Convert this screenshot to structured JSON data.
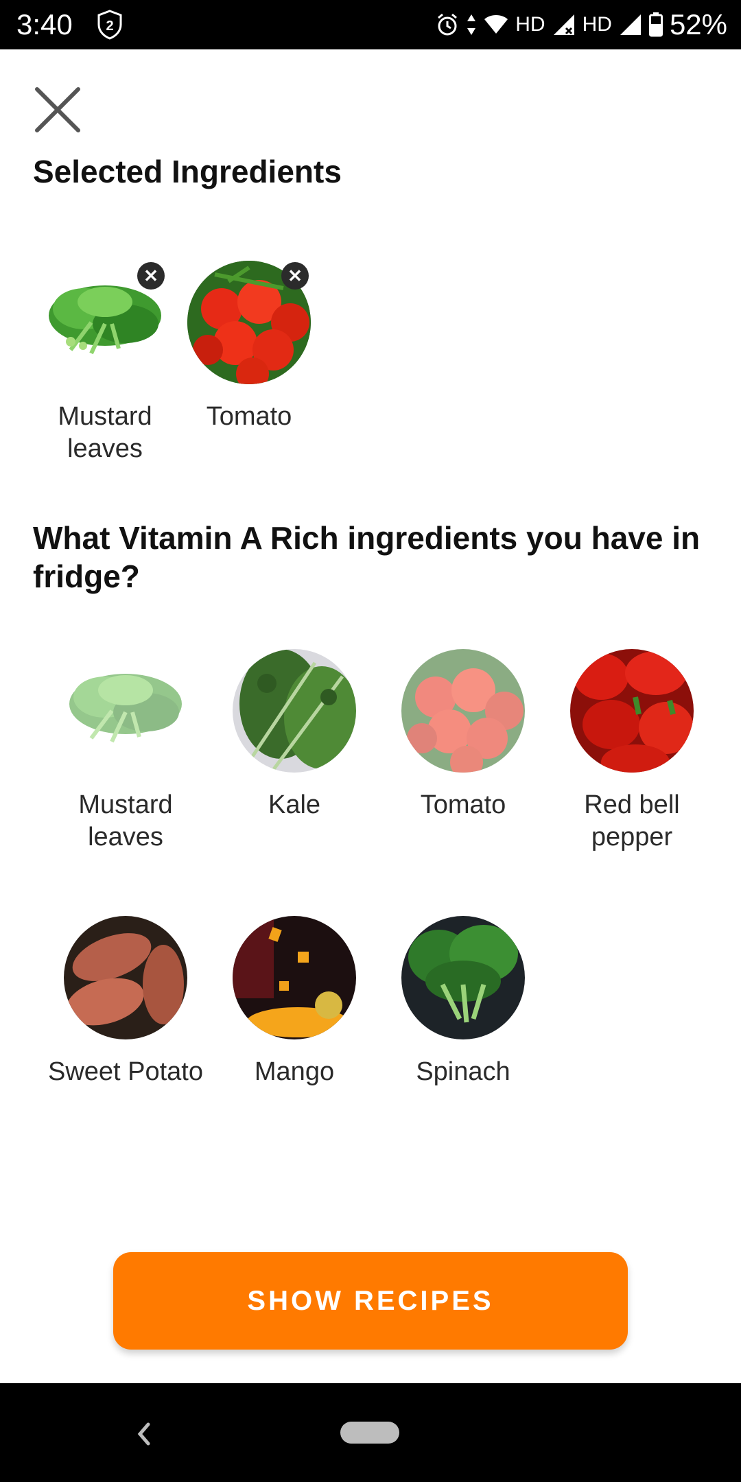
{
  "status_bar": {
    "time": "3:40",
    "badge": "2",
    "net1": "HD",
    "net2": "HD",
    "battery": "52%"
  },
  "selected": {
    "title": "Selected Ingredients",
    "items": [
      {
        "label": "Mustard leaves",
        "icon": "mustard-leaves-image"
      },
      {
        "label": "Tomato",
        "icon": "tomato-image"
      }
    ]
  },
  "question": {
    "title": "What Vitamin A Rich ingredients you have in fridge?",
    "items": [
      {
        "label": "Mustard leaves",
        "icon": "mustard-leaves-image",
        "selected": true
      },
      {
        "label": "Kale",
        "icon": "kale-image",
        "selected": false
      },
      {
        "label": "Tomato",
        "icon": "tomato-image",
        "selected": true
      },
      {
        "label": "Red bell pepper",
        "icon": "red-bell-pepper-image",
        "selected": false
      },
      {
        "label": "Sweet Potato",
        "icon": "sweet-potato-image",
        "selected": false
      },
      {
        "label": "Mango",
        "icon": "mango-image",
        "selected": false
      },
      {
        "label": "Spinach",
        "icon": "spinach-image",
        "selected": false
      }
    ]
  },
  "button": {
    "label": "SHOW RECIPES"
  },
  "colors": {
    "accent": "#ff7a00",
    "text": "#111111"
  }
}
